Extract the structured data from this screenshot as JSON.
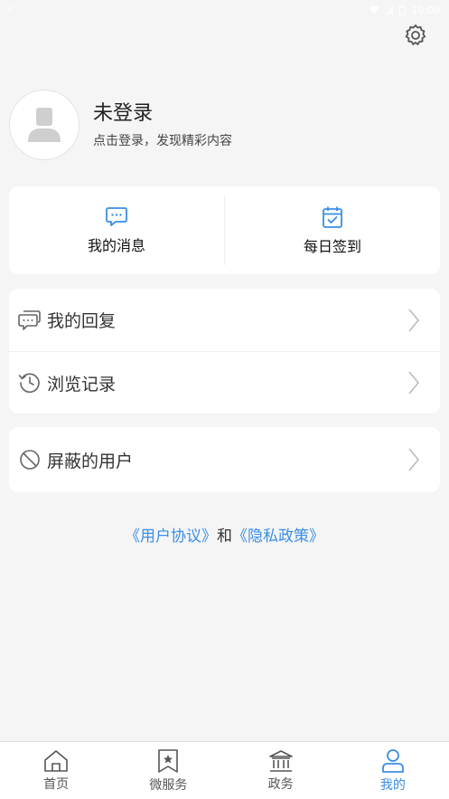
{
  "status_bar": {
    "time": "10:00",
    "icons": [
      "wifi-icon",
      "signal-icon",
      "battery-icon"
    ]
  },
  "header": {
    "settings_icon": "gear-icon"
  },
  "profile": {
    "title": "未登录",
    "subtitle": "点击登录，发现精彩内容",
    "avatar_icon": "user-placeholder-icon"
  },
  "quick_actions": [
    {
      "label": "我的消息",
      "icon": "message-icon"
    },
    {
      "label": "每日签到",
      "icon": "calendar-check-icon"
    }
  ],
  "menu_group_1": [
    {
      "label": "我的回复",
      "icon": "reply-chat-icon"
    },
    {
      "label": "浏览记录",
      "icon": "history-icon"
    }
  ],
  "menu_group_2": [
    {
      "label": "屏蔽的用户",
      "icon": "block-icon"
    }
  ],
  "agreements": {
    "user_agreement": "《用户协议》",
    "and": "和",
    "privacy_policy": "《隐私政策》"
  },
  "tabbar": [
    {
      "label": "首页",
      "icon": "home-icon",
      "active": false
    },
    {
      "label": "微服务",
      "icon": "bookmark-star-icon",
      "active": false
    },
    {
      "label": "政务",
      "icon": "government-building-icon",
      "active": false
    },
    {
      "label": "我的",
      "icon": "user-icon",
      "active": true
    }
  ],
  "colors": {
    "accent": "#3a8ee6",
    "background": "#f5f5f5",
    "card": "#ffffff"
  }
}
